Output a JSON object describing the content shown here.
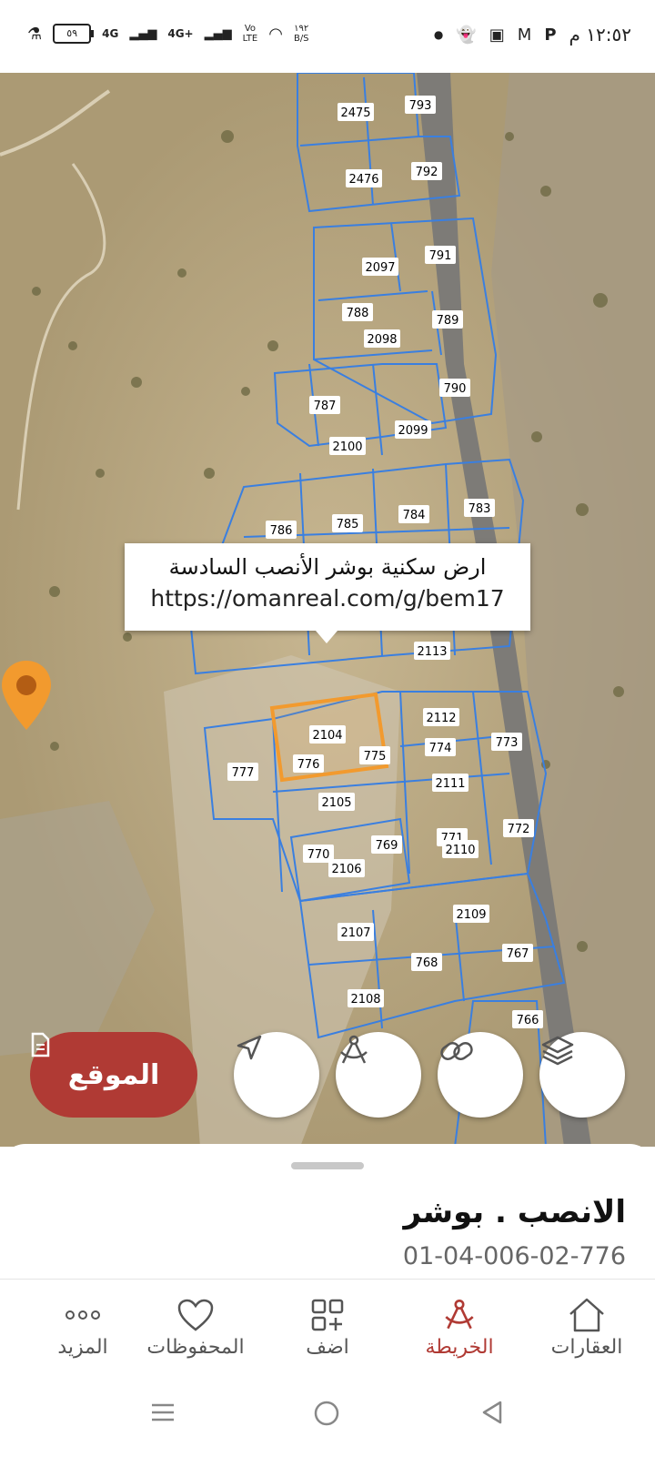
{
  "status_bar": {
    "time": "١٢:٥٢ م",
    "battery": "٥٩",
    "signal1": "4G",
    "signal2": "4G+",
    "volte_top": "Vo",
    "volte_bottom": "LTE",
    "speed_value": "١٩٢",
    "speed_unit": "B/S",
    "notification_icons": [
      "dot-icon",
      "snapchat-icon",
      "sim-icon",
      "gmail-icon",
      "p-icon"
    ]
  },
  "map": {
    "parcels": [
      "2475",
      "793",
      "2476",
      "792",
      "2097",
      "791",
      "788",
      "789",
      "2098",
      "787",
      "790",
      "2100",
      "2099",
      "786",
      "785",
      "784",
      "783",
      "2113",
      "2112",
      "774",
      "773",
      "777",
      "776",
      "775",
      "2104",
      "2105",
      "2111",
      "770",
      "769",
      "771",
      "2110",
      "772",
      "2106",
      "2109",
      "2107",
      "768",
      "767",
      "2108",
      "766"
    ]
  },
  "popup": {
    "title": "ارض سكنية بوشر الأنصب السادسة",
    "url": "https://omanreal.com/g/bem17"
  },
  "location_button": {
    "label": "الموقع"
  },
  "map_controls": [
    "navigate-icon",
    "measure-icon",
    "link-icon",
    "layers-icon"
  ],
  "sheet": {
    "name": "الانصب . بوشر",
    "code": "01-04-006-02-776"
  },
  "bottom_nav": {
    "more": "المزيد",
    "saved": "المحفوظات",
    "add": "اضف",
    "map": "الخريطة",
    "properties": "العقارات"
  },
  "colors": {
    "accent": "#b03a34",
    "parcel_line": "#3a7fe0",
    "highlight": "#f29a2e"
  }
}
